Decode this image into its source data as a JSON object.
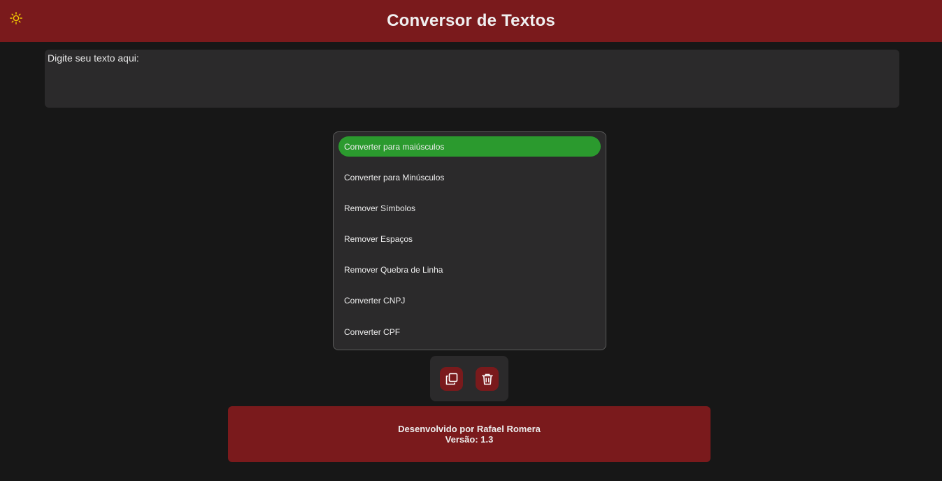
{
  "header": {
    "title": "Conversor de Textos",
    "theme_icon": "sun-icon",
    "theme_icon_color": "#f5d000",
    "background": "#7a1a1c"
  },
  "input": {
    "placeholder": "Digite seu texto aqui:",
    "value": ""
  },
  "options": {
    "items": [
      {
        "label": "Converter para maiúsculos",
        "active": true
      },
      {
        "label": "Converter para Minúsculos",
        "active": false
      },
      {
        "label": "Remover Símbolos",
        "active": false
      },
      {
        "label": "Remover Espaços",
        "active": false
      },
      {
        "label": "Remover Quebra de Linha",
        "active": false
      },
      {
        "label": "Converter CNPJ",
        "active": false
      },
      {
        "label": "Converter CPF",
        "active": false
      }
    ],
    "active_color": "#2b9a2e"
  },
  "actions": {
    "copy_icon": "copy-icon",
    "trash_icon": "trash-icon"
  },
  "footer": {
    "developer": "Desenvolvido por Rafael Romera",
    "version": "Versão: 1.3"
  },
  "colors": {
    "page_background": "#171717",
    "panel_background": "#2b2a2b",
    "accent_red": "#7a1a1c"
  }
}
